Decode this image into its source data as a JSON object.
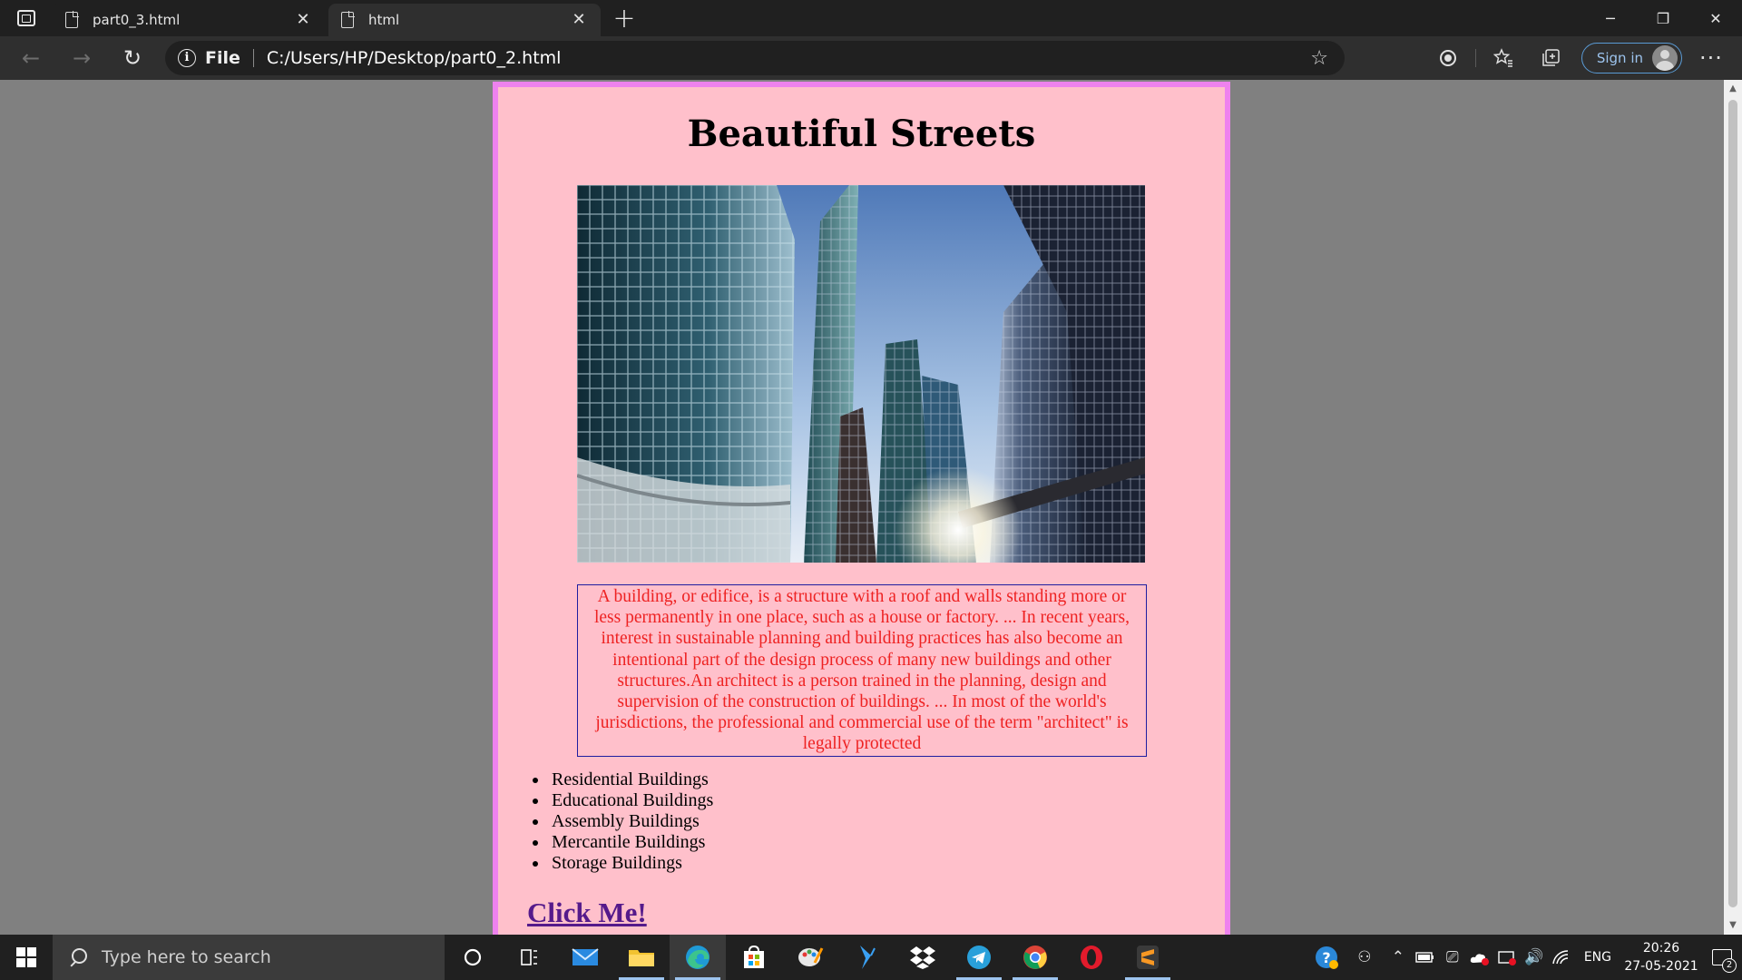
{
  "browser": {
    "tabs": [
      {
        "title": "part0_3.html",
        "active": false
      },
      {
        "title": "html",
        "active": true
      }
    ],
    "address": {
      "scheme_label": "File",
      "url": "C:/Users/HP/Desktop/part0_2.html"
    },
    "signin_label": "Sign in"
  },
  "page": {
    "title": "Beautiful Streets",
    "description": "A building, or edifice, is a structure with a roof and walls standing more or less permanently in one place, such as a house or factory. ... In recent years, interest in sustainable planning and building practices has also become an intentional part of the design process of many new buildings and other structures.An architect is a person trained in the planning, design and supervision of the construction of buildings. ... In most of the world's jurisdictions, the professional and commercial use of the term \"architect\" is legally protected",
    "list": [
      "Residential Buildings",
      "Educational Buildings",
      "Assembly Buildings",
      "Mercantile Buildings",
      "Storage Buildings"
    ],
    "link_label": "Click Me!",
    "colors": {
      "background": "#ffc0cb",
      "border": "#ee82ee",
      "description_text": "#ee2222",
      "link": "#551a8b"
    }
  },
  "taskbar": {
    "search_placeholder": "Type here to search",
    "language": "ENG",
    "time": "20:26",
    "date": "27-05-2021",
    "notification_count": "2",
    "apps": [
      "cortana-icon",
      "task-view-icon",
      "mail-icon",
      "file-explorer-icon",
      "edge-icon",
      "store-icon",
      "paint-icon",
      "vscode-icon",
      "dropbox-icon",
      "telegram-icon",
      "chrome-icon",
      "opera-icon",
      "sublime-icon"
    ]
  }
}
